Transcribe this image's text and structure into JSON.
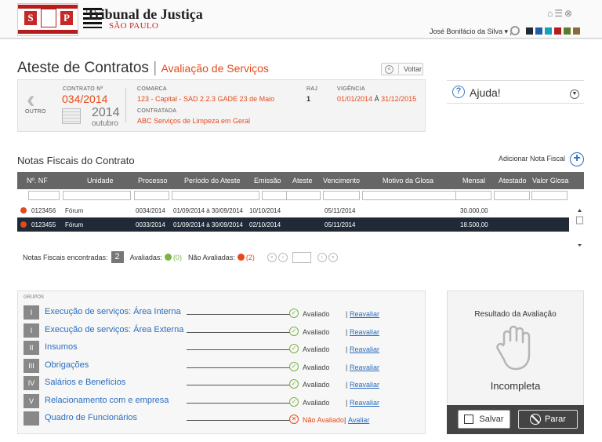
{
  "header": {
    "logo_text": "SP",
    "title": "Tribunal de Justiça",
    "subtitle": "SÃO PAULO",
    "user": "José Bonifácio da Silva ▾  |",
    "swatches": [
      "#1f2a36",
      "#1f5fa8",
      "#17a2b8",
      "#b71c1c",
      "#5a7d2a",
      "#8c6b3a"
    ]
  },
  "page": {
    "title": "Ateste de Contratos",
    "separator": "|",
    "subtitle": "Avaliação de Serviços",
    "back_label": "Voltar"
  },
  "contract": {
    "other_label": "OUTRO",
    "number_label": "CONTRATO Nº",
    "number": "034/2014",
    "year": "2014",
    "month": "outubro",
    "comarca_label": "COMARCA",
    "comarca": "123 - Capital - SAD 2.2.3 GADE 23 de Maio",
    "contratada_label": "CONTRATADA",
    "contratada": "ABC Serviços de Limpeza em Geral",
    "raj_label": "RAJ",
    "raj": "1",
    "vigencia_label": "VIGÊNCIA",
    "vig_start": "01/01/2014",
    "vig_sep": "À",
    "vig_end": "31/12/2015"
  },
  "help": {
    "label": "Ajuda!"
  },
  "invoices": {
    "section_title": "Notas Fiscais do Contrato",
    "add_label": "Adicionar Nota Fiscal",
    "columns": [
      "Nº. NF",
      "Unidade",
      "Processo",
      "Período do Ateste",
      "Emissão",
      "Ateste",
      "Vencimento",
      "Motivo da Glosa",
      "Mensal",
      "Atestado",
      "Valor Glosa"
    ],
    "rows": [
      {
        "nf": "0123456",
        "unidade": "Fórum",
        "processo": "0034/2014",
        "periodo": "01/09/2014 à 30/09/2014",
        "emissao": "10/10/2014",
        "vencimento": "05/11/2014",
        "mensal": "30.000,00"
      },
      {
        "nf": "0123455",
        "unidade": "Fórum",
        "processo": "0033/2014",
        "periodo": "01/09/2014 à 30/09/2014",
        "emissao": "02/10/2014",
        "vencimento": "05/11/2014",
        "mensal": "18.500,00"
      }
    ],
    "found_label": "Notas Fiscais encontradas:",
    "found_count": "2",
    "evaluated_label": "Avaliadas:",
    "evaluated_count": "(0)",
    "not_evaluated_label": "Não Avaliadas:",
    "not_evaluated_count": "(2)"
  },
  "groups": {
    "label": "GRUPOS",
    "items": [
      {
        "num": "I",
        "name": "Execução de serviços: Área Interna",
        "status": "Avaliado",
        "action": "Reavaliar",
        "ok": true
      },
      {
        "num": "I",
        "name": "Execução de serviços: Área Externa",
        "status": "Avaliado",
        "action": "Reavaliar",
        "ok": true
      },
      {
        "num": "II",
        "name": "Insumos",
        "status": "Avaliado",
        "action": "Reavaliar",
        "ok": true
      },
      {
        "num": "III",
        "name": "Obrigações",
        "status": "Avaliado",
        "action": "Reavaliar",
        "ok": true
      },
      {
        "num": "IV",
        "name": "Salários e Benefícios",
        "status": "Avaliado",
        "action": "Reavaliar",
        "ok": true
      },
      {
        "num": "V",
        "name": "Relacionamento com e empresa",
        "status": "Avaliado",
        "action": "Reavaliar",
        "ok": true
      },
      {
        "num": "",
        "name": "Quadro de Funcionários",
        "status": "Não Avaliado",
        "action": "Avaliar",
        "ok": false
      }
    ],
    "separator": "|"
  },
  "result": {
    "title": "Resultado da Avaliação",
    "state": "Incompleta",
    "save_label": "Salvar",
    "stop_label": "Parar"
  }
}
